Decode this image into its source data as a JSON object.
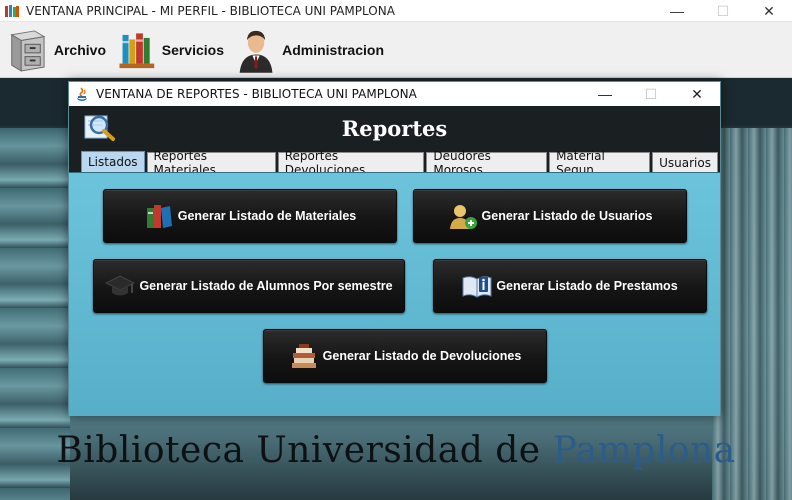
{
  "main_window": {
    "title": "VENTANA PRINCIPAL - MI PERFIL - BIBLIOTECA UNI PAMPLONA",
    "controls": {
      "minimize": "—",
      "maximize": "☐",
      "close": "✕"
    }
  },
  "menubar": {
    "items": [
      {
        "label": "Archivo",
        "icon": "filing-cabinet-icon"
      },
      {
        "label": "Servicios",
        "icon": "books-icon"
      },
      {
        "label": "Administracion",
        "icon": "administrator-icon"
      }
    ]
  },
  "background": {
    "title_part1": "Biblioteca Universidad de ",
    "title_part2": "Pamplona"
  },
  "dialog": {
    "title": "VENTANA DE REPORTES - BIBLIOTECA UNI PAMPLONA",
    "controls": {
      "minimize": "—",
      "maximize": "☐",
      "close": "✕"
    },
    "heading": "Reportes",
    "tabs": [
      {
        "label": "Listados",
        "active": true
      },
      {
        "label": "Reportes Materiales",
        "active": false
      },
      {
        "label": "Reportes Devoluciones",
        "active": false
      },
      {
        "label": "Deudores Morosos",
        "active": false
      },
      {
        "label": "Material Segun",
        "active": false
      },
      {
        "label": "Usuarios",
        "active": false
      }
    ],
    "buttons": {
      "materiales": {
        "label": "Generar Listado de Materiales",
        "icon": "books-icon"
      },
      "usuarios": {
        "label": "Generar Listado de Usuarios",
        "icon": "add-user-icon"
      },
      "alumnos": {
        "label": "Generar Listado de Alumnos Por semestre",
        "icon": "graduation-cap-icon"
      },
      "prestamos": {
        "label": "Generar Listado de Prestamos",
        "icon": "info-book-icon"
      },
      "devoluciones": {
        "label": "Generar Listado de Devoluciones",
        "icon": "book-stack-icon"
      }
    }
  }
}
